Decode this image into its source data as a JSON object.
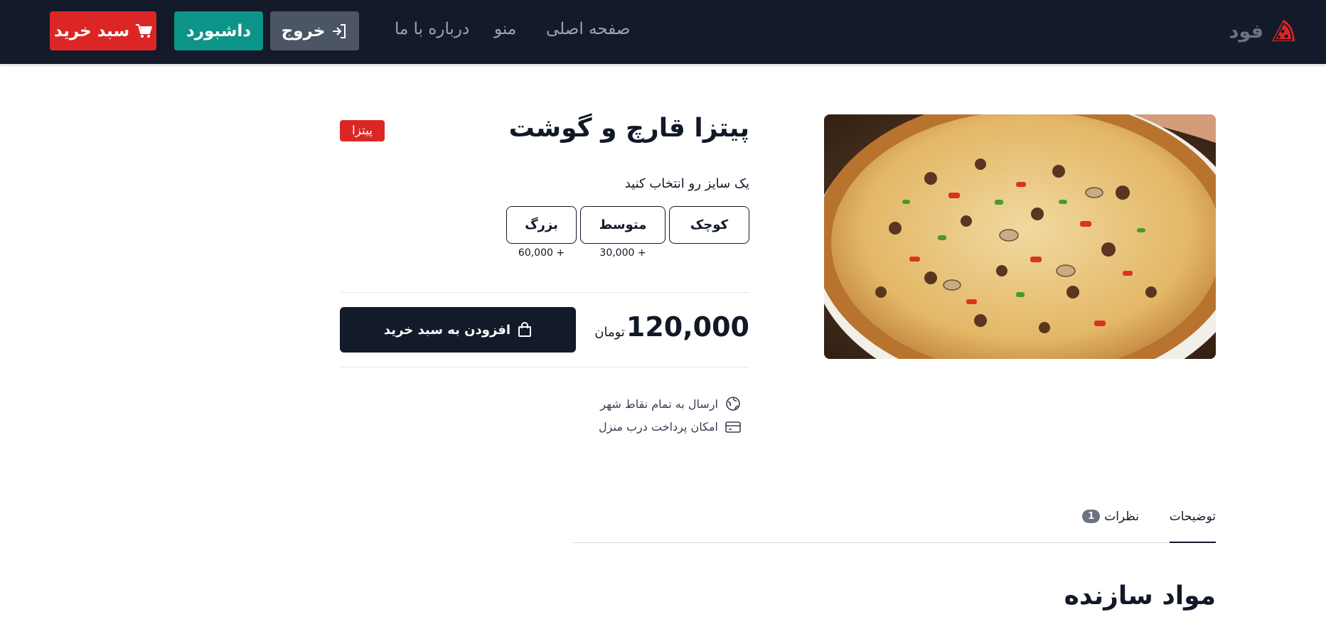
{
  "header": {
    "logo_text": "فود",
    "nav": {
      "home": "صفحه اصلی",
      "menu": "منو",
      "about": "درباره با ما"
    },
    "buttons": {
      "logout": "خروج",
      "dashboard": "داشبورد",
      "cart": "سبد خرید"
    }
  },
  "product": {
    "title": "پیتزا قارچ و گوشت",
    "category_badge": "پیتزا",
    "size_prompt": "یک سایز رو انتخاب کنید",
    "sizes": [
      {
        "label": "کوچک",
        "extra": ""
      },
      {
        "label": "متوسط",
        "extra": "+ 30,000"
      },
      {
        "label": "بزرگ",
        "extra": "+ 60,000"
      }
    ],
    "price_value": "120,000",
    "price_unit": "تومان",
    "add_to_cart": "افزودن به سبد خرید",
    "features": [
      {
        "icon": "globe-icon",
        "text": "ارسال به تمام نقاط شهر"
      },
      {
        "icon": "credit-card-icon",
        "text": "امکان پرداخت درب منزل"
      }
    ]
  },
  "tabs": {
    "description": "توضیحات",
    "reviews": "نظرات",
    "reviews_count": "1"
  },
  "section": {
    "ingredients_title": "مواد سازنده"
  },
  "colors": {
    "header_bg": "#131a2a",
    "brand_red": "#dc2626",
    "teal": "#0d9488",
    "gray_button": "#4b5563"
  }
}
